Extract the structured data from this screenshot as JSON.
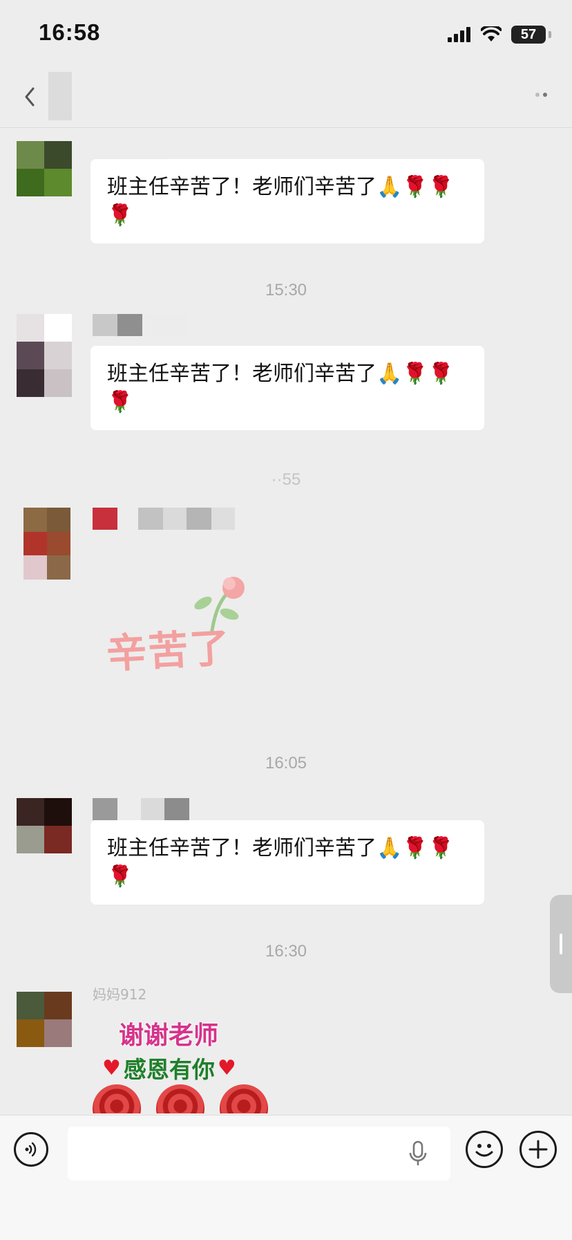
{
  "status_bar": {
    "time": "16:58",
    "battery": "57",
    "icons": [
      "signal-icon",
      "wifi-icon",
      "battery-icon"
    ]
  },
  "nav": {
    "back_icon": "back-chevron-icon",
    "more_icon": "more-icon"
  },
  "messages": [
    {
      "type": "text",
      "text": "班主任辛苦了！老师们辛苦了🙏🌹🌹🌹"
    },
    {
      "type": "timestamp",
      "text": "15:30"
    },
    {
      "type": "text",
      "text": "班主任辛苦了！老师们辛苦了🙏🌹🌹🌹"
    },
    {
      "type": "timestamp",
      "text": "··55"
    },
    {
      "type": "sticker",
      "text": "辛苦了"
    },
    {
      "type": "timestamp",
      "text": "16:05"
    },
    {
      "type": "text",
      "text": "班主任辛苦了！老师们辛苦了🙏🌹🌹🌹"
    },
    {
      "type": "timestamp",
      "text": "16:30"
    },
    {
      "type": "sticker",
      "sender": "妈妈912",
      "line1": "谢谢老师",
      "line2": "感恩有你"
    }
  ],
  "input_bar": {
    "placeholder": "",
    "icons": [
      "voice-icon",
      "mic-icon",
      "emoji-icon",
      "plus-icon"
    ]
  },
  "colors": {
    "background": "#ededed",
    "bubble": "#ffffff",
    "timestamp": "#a8a8a8"
  }
}
